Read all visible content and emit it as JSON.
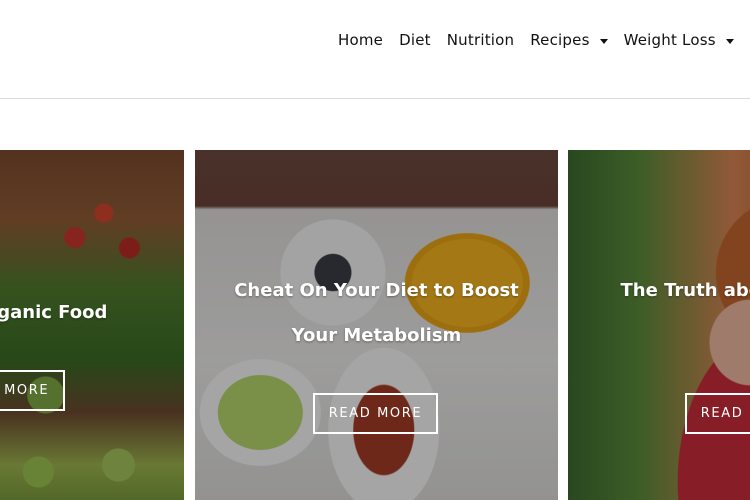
{
  "nav": {
    "items": [
      {
        "label": "Home"
      },
      {
        "label": "Diet"
      },
      {
        "label": "Nutrition"
      },
      {
        "label": "Recipes"
      },
      {
        "label": "Weight Loss"
      }
    ]
  },
  "slider": {
    "cards": [
      {
        "title": "Buying Organic Food",
        "button": "READ MORE"
      },
      {
        "title": "Cheat On Your Diet to Boost Your Metabolism",
        "button": "READ MORE"
      },
      {
        "title": "The Truth about Diet Pills",
        "button": "READ MORE"
      }
    ]
  }
}
